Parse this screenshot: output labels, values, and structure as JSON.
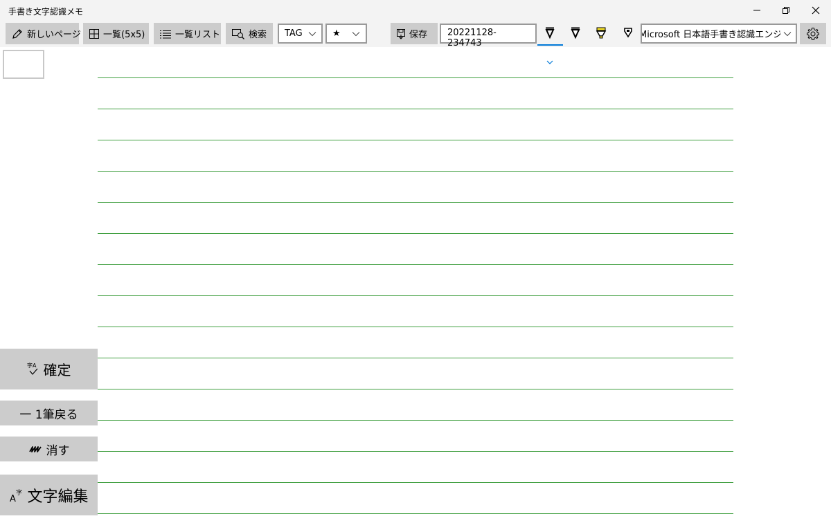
{
  "window": {
    "title": "手書き文字認識メモ"
  },
  "toolbar": {
    "new_page": "新しいページ",
    "grid_view": "一覧(5x5)",
    "list_view": "一覧リスト",
    "search": "検索",
    "tag_combo": "TAG",
    "star_combo": "★",
    "save": "保存",
    "filename": "20221128-234743",
    "recognizer": "Microsoft 日本語手書き認識エンジン",
    "pens": [
      "black-pen-icon",
      "black-pen-icon",
      "yellow-highlighter-icon",
      "eraser-pen-icon"
    ],
    "selected_pen": 0
  },
  "side": {
    "confirm": "確定",
    "undo_stroke": "一 1筆戻る",
    "erase": "消す",
    "text_edit": "文字編集"
  },
  "colors": {
    "rule_line": "#3e9e3e",
    "button_bg": "#cccccc",
    "accent": "#0078d7",
    "highlighter": "#f5e12a"
  }
}
